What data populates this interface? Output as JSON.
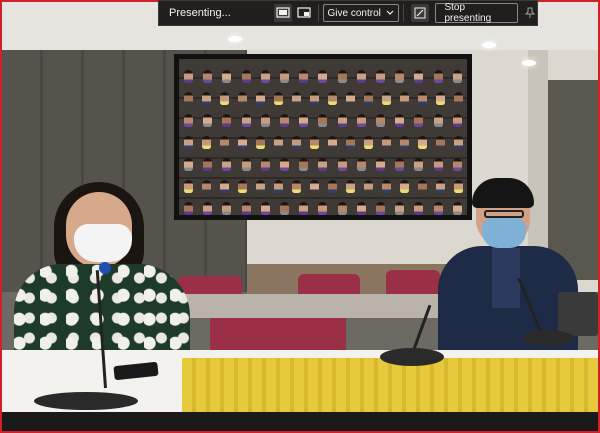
{
  "toolbar": {
    "status_label": "Presenting...",
    "give_control_label": "Give control",
    "stop_presenting_label": "Stop presenting",
    "icons": [
      "include-computer-sound-icon",
      "share-window-icon",
      "chevron-down-icon",
      "annotate-icon",
      "pin-icon"
    ]
  },
  "colors": {
    "border": "#d0202a",
    "toolbar_bg": "#201f1e",
    "toolbar_text": "#f3f2f1"
  }
}
